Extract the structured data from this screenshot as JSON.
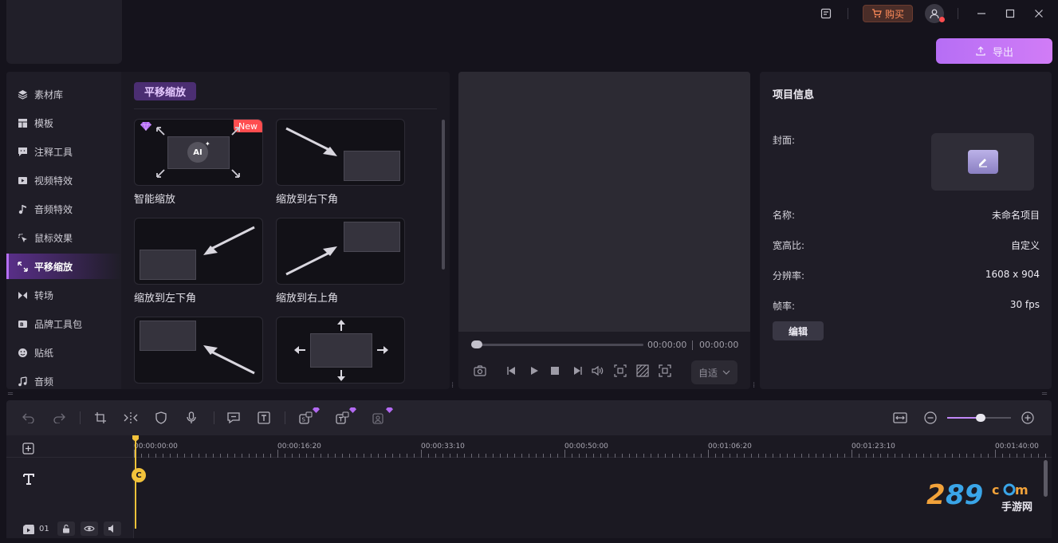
{
  "titlebar": {
    "buy_label": "购买"
  },
  "export": {
    "label": "导出"
  },
  "nav": {
    "items": [
      {
        "label": "素材库"
      },
      {
        "label": "模板"
      },
      {
        "label": "注释工具"
      },
      {
        "label": "视频特效"
      },
      {
        "label": "音频特效"
      },
      {
        "label": "鼠标效果"
      },
      {
        "label": "平移缩放",
        "active": true
      },
      {
        "label": "转场"
      },
      {
        "label": "品牌工具包"
      },
      {
        "label": "贴纸"
      },
      {
        "label": "音频"
      }
    ]
  },
  "content": {
    "section_title": "平移缩放",
    "tiles": [
      {
        "label": "智能缩放",
        "badge": "New",
        "ai_text": "AI"
      },
      {
        "label": "缩放到右下角"
      },
      {
        "label": "缩放到左下角"
      },
      {
        "label": "缩放到右上角"
      },
      {
        "label": ""
      },
      {
        "label": ""
      }
    ]
  },
  "preview": {
    "current_time": "00:00:00",
    "total_time": "00:00:00",
    "ratio_label": "自适"
  },
  "project": {
    "title": "项目信息",
    "cover_label": "封面:",
    "name_label": "名称:",
    "name_value": "未命名项目",
    "aspect_label": "宽高比:",
    "aspect_value": "自定义",
    "resolution_label": "分辨率:",
    "resolution_value": "1608 x 904",
    "fps_label": "帧率:",
    "fps_value": "30 fps",
    "edit_label": "编辑"
  },
  "timeline": {
    "ruler_labels": [
      "00:00:00:00",
      "00:00:16:20",
      "00:00:33:10",
      "00:00:50:00",
      "00:01:06:20",
      "00:01:23:10",
      "00:01:40:00"
    ],
    "track_number": "01",
    "clip_letter": "C",
    "zoom_fraction": 0.54
  },
  "colors": {
    "accent": "#b66ef5",
    "buy": "#ff8c5a",
    "playhead": "#f2c23b",
    "badge_new": "#ff4d4f"
  },
  "icons": [
    "notes-icon",
    "cart-icon",
    "user-icon",
    "minimize-icon",
    "maximize-icon",
    "close-icon",
    "upload-icon",
    "undo-icon",
    "redo-icon",
    "crop-icon",
    "split-icon",
    "shield-icon",
    "mic-icon",
    "caption-icon",
    "text-icon",
    "fit-icon",
    "zoom-out-icon",
    "zoom-in-icon"
  ]
}
